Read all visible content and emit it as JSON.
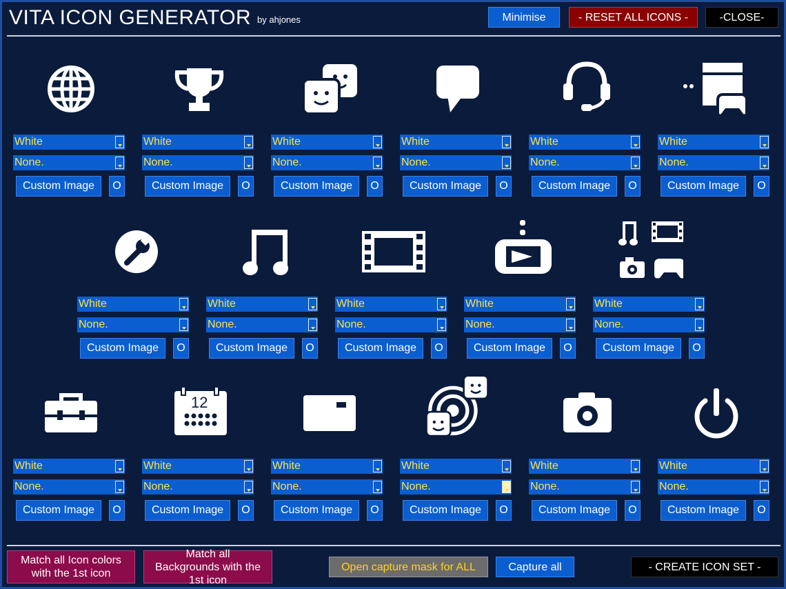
{
  "header": {
    "title": "VITA ICON GENERATOR",
    "byline": "by ahjones",
    "minimise": "Minimise",
    "reset": "- RESET ALL ICONS -",
    "close": "-CLOSE-"
  },
  "icons": [
    {
      "name": "globe-icon",
      "color": "White",
      "background": "None.",
      "custom": "Custom Image",
      "o": "O"
    },
    {
      "name": "trophy-icon",
      "color": "White",
      "background": "None.",
      "custom": "Custom Image",
      "o": "O"
    },
    {
      "name": "friends-icon",
      "color": "White",
      "background": "None.",
      "custom": "Custom Image",
      "o": "O"
    },
    {
      "name": "message-icon",
      "color": "White",
      "background": "None.",
      "custom": "Custom Image",
      "o": "O"
    },
    {
      "name": "headset-icon",
      "color": "White",
      "background": "None.",
      "custom": "Custom Image",
      "o": "O"
    },
    {
      "name": "remote-play-icon",
      "color": "White",
      "background": "None.",
      "custom": "Custom Image",
      "o": "O"
    },
    {
      "name": "settings-wrench-icon",
      "color": "White",
      "background": "None.",
      "custom": "Custom Image",
      "o": "O"
    },
    {
      "name": "music-note-icon",
      "color": "White",
      "background": "None.",
      "custom": "Custom Image",
      "o": "O"
    },
    {
      "name": "film-strip-icon",
      "color": "White",
      "background": "None.",
      "custom": "Custom Image",
      "o": "O"
    },
    {
      "name": "video-player-icon",
      "color": "White",
      "background": "None.",
      "custom": "Custom Image",
      "o": "O"
    },
    {
      "name": "content-manager-icon",
      "color": "White",
      "background": "None.",
      "custom": "Custom Image",
      "o": "O"
    },
    {
      "name": "toolbox-icon",
      "color": "White",
      "background": "None.",
      "custom": "Custom Image",
      "o": "O"
    },
    {
      "name": "calendar-icon",
      "color": "White",
      "background": "None.",
      "custom": "Custom Image",
      "o": "O",
      "label": "12"
    },
    {
      "name": "email-icon",
      "color": "White",
      "background": "None.",
      "custom": "Custom Image",
      "o": "O"
    },
    {
      "name": "near-icon",
      "color": "White",
      "background": "None.",
      "custom": "Custom Image",
      "o": "O"
    },
    {
      "name": "camera-icon",
      "color": "White",
      "background": "None.",
      "custom": "Custom Image",
      "o": "O"
    },
    {
      "name": "power-icon",
      "color": "White",
      "background": "None.",
      "custom": "Custom Image",
      "o": "O"
    }
  ],
  "footer": {
    "match_colors": "Match all Icon colors with the 1st icon",
    "match_backgrounds": "Match all Backgrounds with the 1st icon",
    "open_capture": "Open capture mask for ALL",
    "capture_all": "Capture all",
    "create": "- CREATE ICON SET -"
  },
  "colors": {
    "background": "#0b1b3b",
    "button_blue": "#0b5ed0",
    "dropdown_text": "#ffe24a",
    "reset_red": "#8a0000",
    "match_maroon": "#8c0b4b"
  }
}
